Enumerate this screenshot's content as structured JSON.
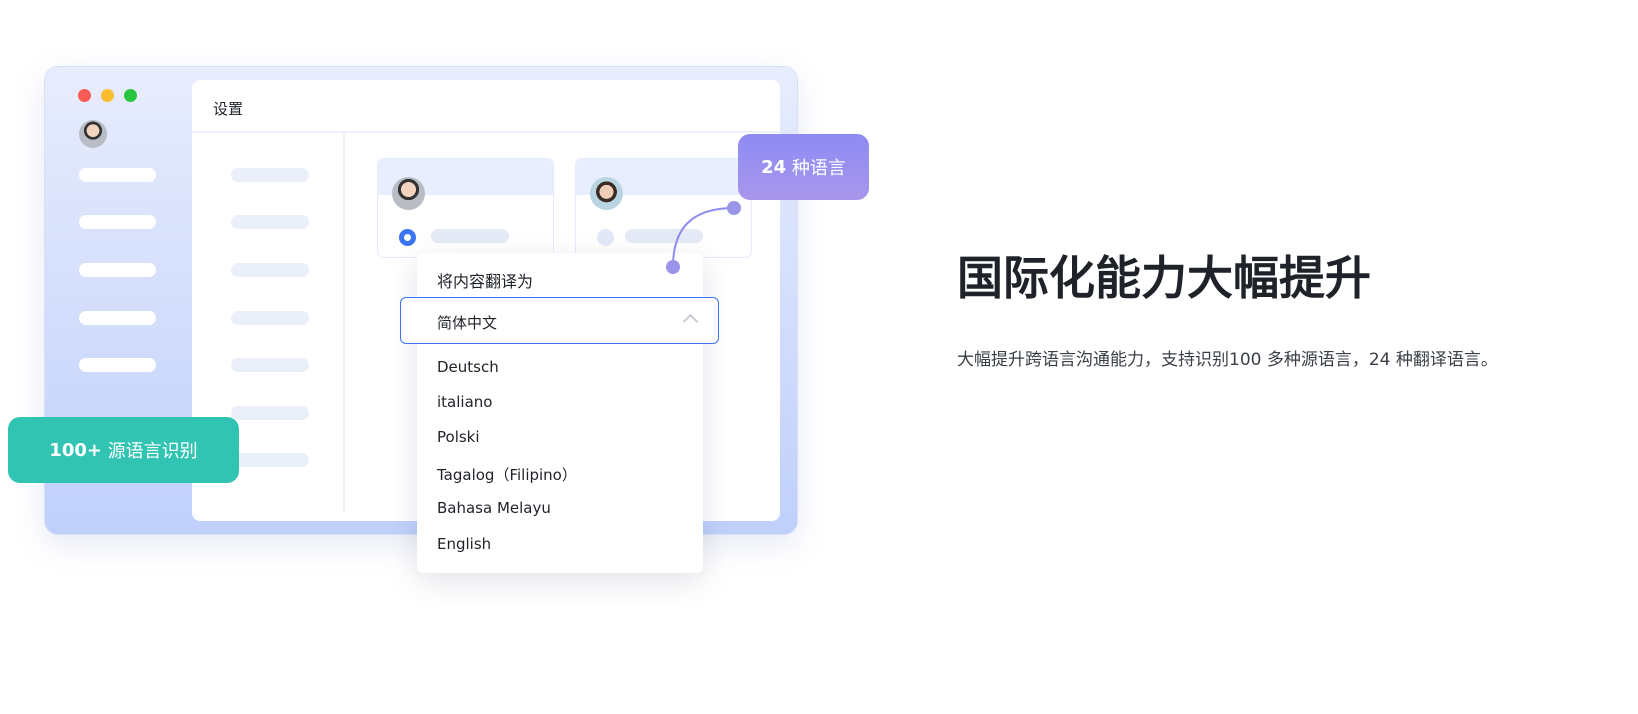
{
  "window": {
    "title": "设置",
    "colors": {
      "close": "#f85a55",
      "minimize": "#fbbd2e",
      "maximize": "#28c73f"
    }
  },
  "popup": {
    "title": "将内容翻译为",
    "selected": "简体中文",
    "options": [
      "Deutsch",
      "italiano",
      "Polski",
      "Tagalog（Filipino）",
      "Bahasa Melayu",
      "English"
    ]
  },
  "badges": {
    "target_count": "24",
    "target_label": "种语言",
    "source_count": "100+",
    "source_label": "源语言识别"
  },
  "feature": {
    "heading": "国际化能力大幅提升",
    "description": "大幅提升跨语言沟通能力，支持识别100 多种源语言，24 种翻译语言。"
  },
  "colors": {
    "accent": "#3b74f5",
    "purple": "#8e8bf5",
    "teal": "#31c4b3"
  }
}
